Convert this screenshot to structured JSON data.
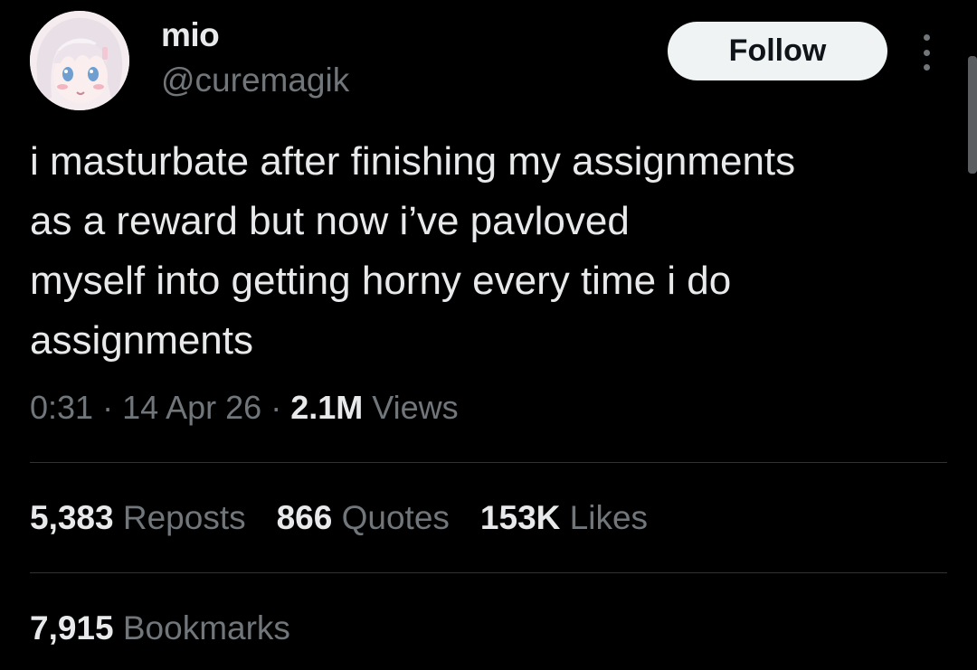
{
  "author": {
    "display_name": "mio",
    "handle": "@curemagik"
  },
  "actions": {
    "follow_label": "Follow",
    "more_icon": "more-vertical-icon"
  },
  "tweet": {
    "lines": [
      "i masturbate after finishing my assignments",
      "as a reward but now i’ve pavloved",
      "myself into getting horny every time i do",
      "assignments"
    ]
  },
  "meta": {
    "time": "0:31",
    "sep1": " · ",
    "date": "14 Apr 26",
    "sep2": " · ",
    "views_count": "2.1M",
    "views_label": " Views"
  },
  "stats": {
    "reposts_count": "5,383",
    "reposts_label": " Reposts",
    "quotes_count": "866",
    "quotes_label": " Quotes",
    "likes_count": "153K",
    "likes_label": " Likes",
    "bookmarks_count": "7,915",
    "bookmarks_label": " Bookmarks"
  },
  "colors": {
    "background": "#000000",
    "primary_text": "#e7e9ea",
    "secondary_text": "#71767b",
    "divider": "#2f3336",
    "follow_bg": "#eff3f4",
    "follow_text": "#0f1419"
  }
}
